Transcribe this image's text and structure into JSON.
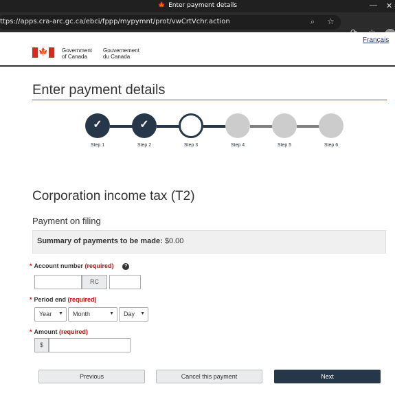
{
  "window": {
    "title": "Enter payment details"
  },
  "browser": {
    "url": "ttps://apps.cra-arc.gc.ca/ebci/fppp/mypymnt/prot/vwCrtVchr.action"
  },
  "header": {
    "language_link": "Français",
    "gov_en_line1": "Government",
    "gov_en_line2": "of Canada",
    "gov_fr_line1": "Gouvernement",
    "gov_fr_line2": "du Canada"
  },
  "page": {
    "title": "Enter payment details",
    "section_title": "Corporation income tax (T2)",
    "subsection_title": "Payment on filing",
    "summary_label": "Summary of payments to be made:",
    "summary_value": "$0.00"
  },
  "steps": [
    {
      "label": "Step 1",
      "state": "done"
    },
    {
      "label": "Step 2",
      "state": "done"
    },
    {
      "label": "Step 3",
      "state": "current"
    },
    {
      "label": "Step 4",
      "state": "todo"
    },
    {
      "label": "Step 5",
      "state": "todo"
    },
    {
      "label": "Step 6",
      "state": "todo"
    }
  ],
  "form": {
    "account": {
      "label": "Account number",
      "required": "(required)",
      "rc_text": "RC",
      "part1_value": "",
      "part2_value": ""
    },
    "period": {
      "label": "Period end",
      "required": "(required)",
      "year": "Year",
      "month": "Month",
      "day": "Day"
    },
    "amount": {
      "label": "Amount",
      "required": "(required)",
      "currency": "$",
      "value": ""
    }
  },
  "buttons": {
    "previous": "Previous",
    "cancel": "Cancel this payment",
    "next": "Next"
  },
  "colors": {
    "navy": "#26374a",
    "required_red": "#d3080c",
    "canada_red": "#d52b1e",
    "step_todo": "#cccccc"
  }
}
